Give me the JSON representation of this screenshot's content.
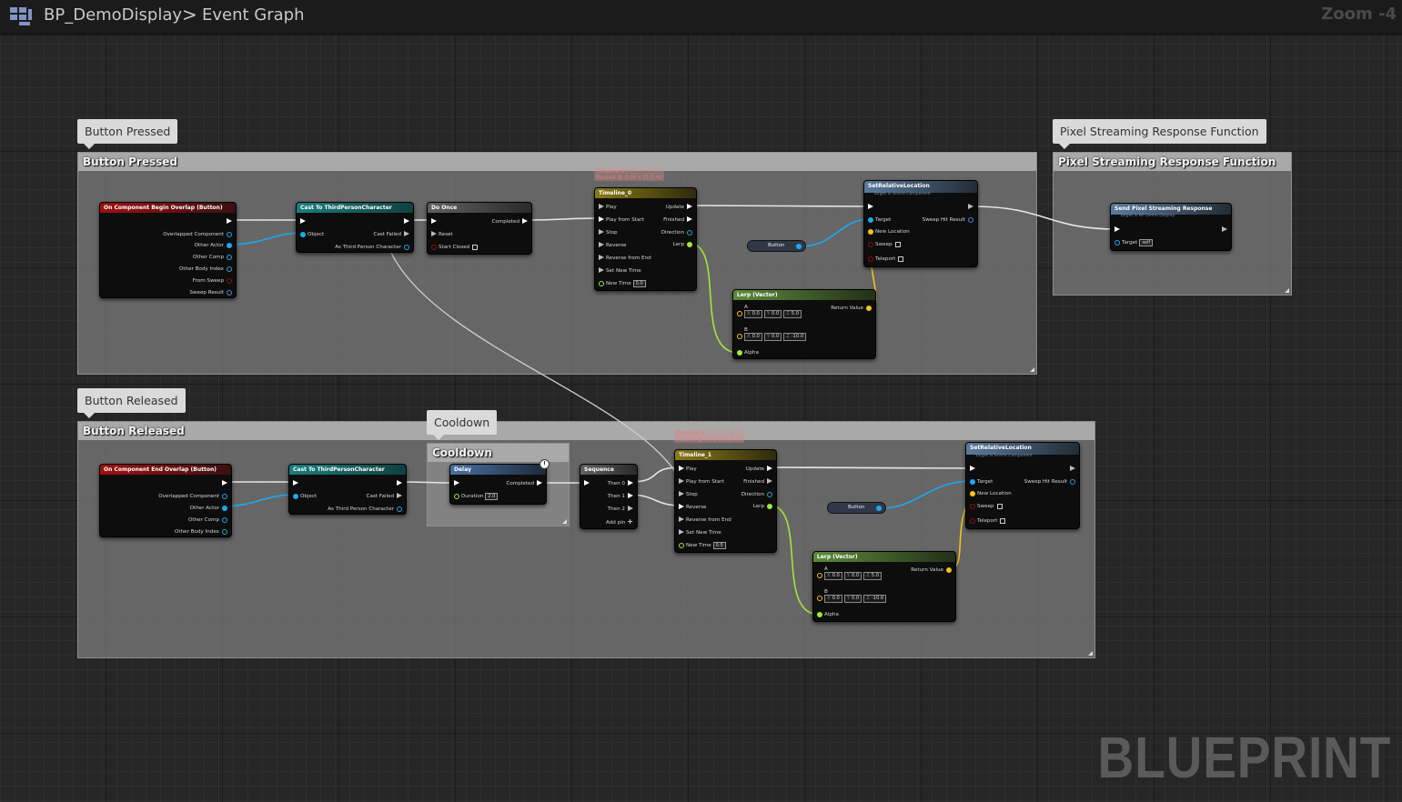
{
  "toolbar": {
    "blueprint_name": "BP_DemoDisplay",
    "separator": ">",
    "graph_name": "Event Graph",
    "zoom": "Zoom -4"
  },
  "watermark": "BLUEPRINT",
  "colors": {
    "exec": "#ffffff",
    "object": "#1da9ef",
    "vector": "#f5c21a",
    "float": "#9ee83a",
    "event_header": "#a01010",
    "cast_header": "#1c7d7d"
  },
  "comments": {
    "button_pressed": {
      "bubble": "Button Pressed",
      "title": "Button Pressed"
    },
    "pixel_streaming": {
      "bubble": "Pixel Streaming Response Function",
      "title": "Pixel Streaming Response Function"
    },
    "button_released": {
      "bubble": "Button Released",
      "title": "Button Released"
    },
    "cooldown": {
      "bubble": "Cooldown",
      "title": "Cooldown"
    }
  },
  "nodes": {
    "begin_overlap": {
      "title": "On Component Begin Overlap (Button)",
      "pins": [
        "Overlapped Component",
        "Other Actor",
        "Other Comp",
        "Other Body Index",
        "From Sweep",
        "Sweep Result"
      ]
    },
    "cast1": {
      "title": "Cast To ThirdPersonCharacter",
      "object": "Object",
      "failed": "Cast Failed",
      "as": "As Third Person Character"
    },
    "do_once": {
      "title": "Do Once",
      "completed": "Completed",
      "reset": "Reset",
      "start_closed": "Start Closed"
    },
    "timeline0": {
      "title": "Timeline_0",
      "label": "Timeline 0",
      "status": "Paused @ 0.00 s (0.0 %)",
      "in": [
        "Play",
        "Play from Start",
        "Stop",
        "Reverse",
        "Reverse from End",
        "Set New Time"
      ],
      "new_time": "New Time",
      "new_time_val": "0.0",
      "out": [
        "Update",
        "Finished",
        "Direction",
        "Lerp"
      ]
    },
    "set_loc1": {
      "title": "SetRelativeLocation",
      "subtitle": "Target is Scene Component",
      "target": "Target",
      "sweep_hit": "Sweep Hit Result",
      "new_location": "New Location",
      "sweep": "Sweep",
      "teleport": "Teleport"
    },
    "button_var1": {
      "label": "Button"
    },
    "lerp1": {
      "title": "Lerp (Vector)",
      "a_label": "A",
      "b_label": "B",
      "alpha": "Alpha",
      "ret": "Return Value",
      "a": [
        "0.0",
        "0.0",
        "5.0"
      ],
      "b": [
        "0.0",
        "0.0",
        "-10.0"
      ],
      "axes": [
        "X",
        "Y",
        "Z"
      ]
    },
    "pixel_resp": {
      "title": "Send Pixel Streaming Response",
      "subtitle": "Target is BP Demo Display",
      "target": "Target",
      "target_val": "self"
    },
    "end_overlap": {
      "title": "On Component End Overlap (Button)",
      "pins": [
        "Overlapped Component",
        "Other Actor",
        "Other Comp",
        "Other Body Index"
      ]
    },
    "cast2": {
      "title": "Cast To ThirdPersonCharacter",
      "object": "Object",
      "failed": "Cast Failed",
      "as": "As Third Person Character"
    },
    "delay": {
      "title": "Delay",
      "completed": "Completed",
      "duration": "Duration",
      "duration_val": "2.0"
    },
    "sequence": {
      "title": "Sequence",
      "outs": [
        "Then 0",
        "Then 1",
        "Then 2"
      ],
      "add_pin": "Add pin"
    },
    "timeline1": {
      "title": "Timeline_1",
      "label": "Timeline 1",
      "status": "Paused @ 0.00 s (0.0 %)",
      "in": [
        "Play",
        "Play from Start",
        "Stop",
        "Reverse",
        "Reverse from End",
        "Set New Time"
      ],
      "new_time": "New Time",
      "new_time_val": "0.0",
      "out": [
        "Update",
        "Finished",
        "Direction",
        "Lerp"
      ]
    },
    "button_var2": {
      "label": "Button"
    },
    "set_loc2": {
      "title": "SetRelativeLocation",
      "subtitle": "Target is Scene Component",
      "target": "Target",
      "sweep_hit": "Sweep Hit Result",
      "new_location": "New Location",
      "sweep": "Sweep",
      "teleport": "Teleport"
    },
    "lerp2": {
      "title": "Lerp (Vector)",
      "a_label": "A",
      "b_label": "B",
      "alpha": "Alpha",
      "ret": "Return Value",
      "a": [
        "0.0",
        "0.0",
        "5.0"
      ],
      "b": [
        "0.0",
        "0.0",
        "-10.0"
      ],
      "axes": [
        "X",
        "Y",
        "Z"
      ]
    }
  }
}
